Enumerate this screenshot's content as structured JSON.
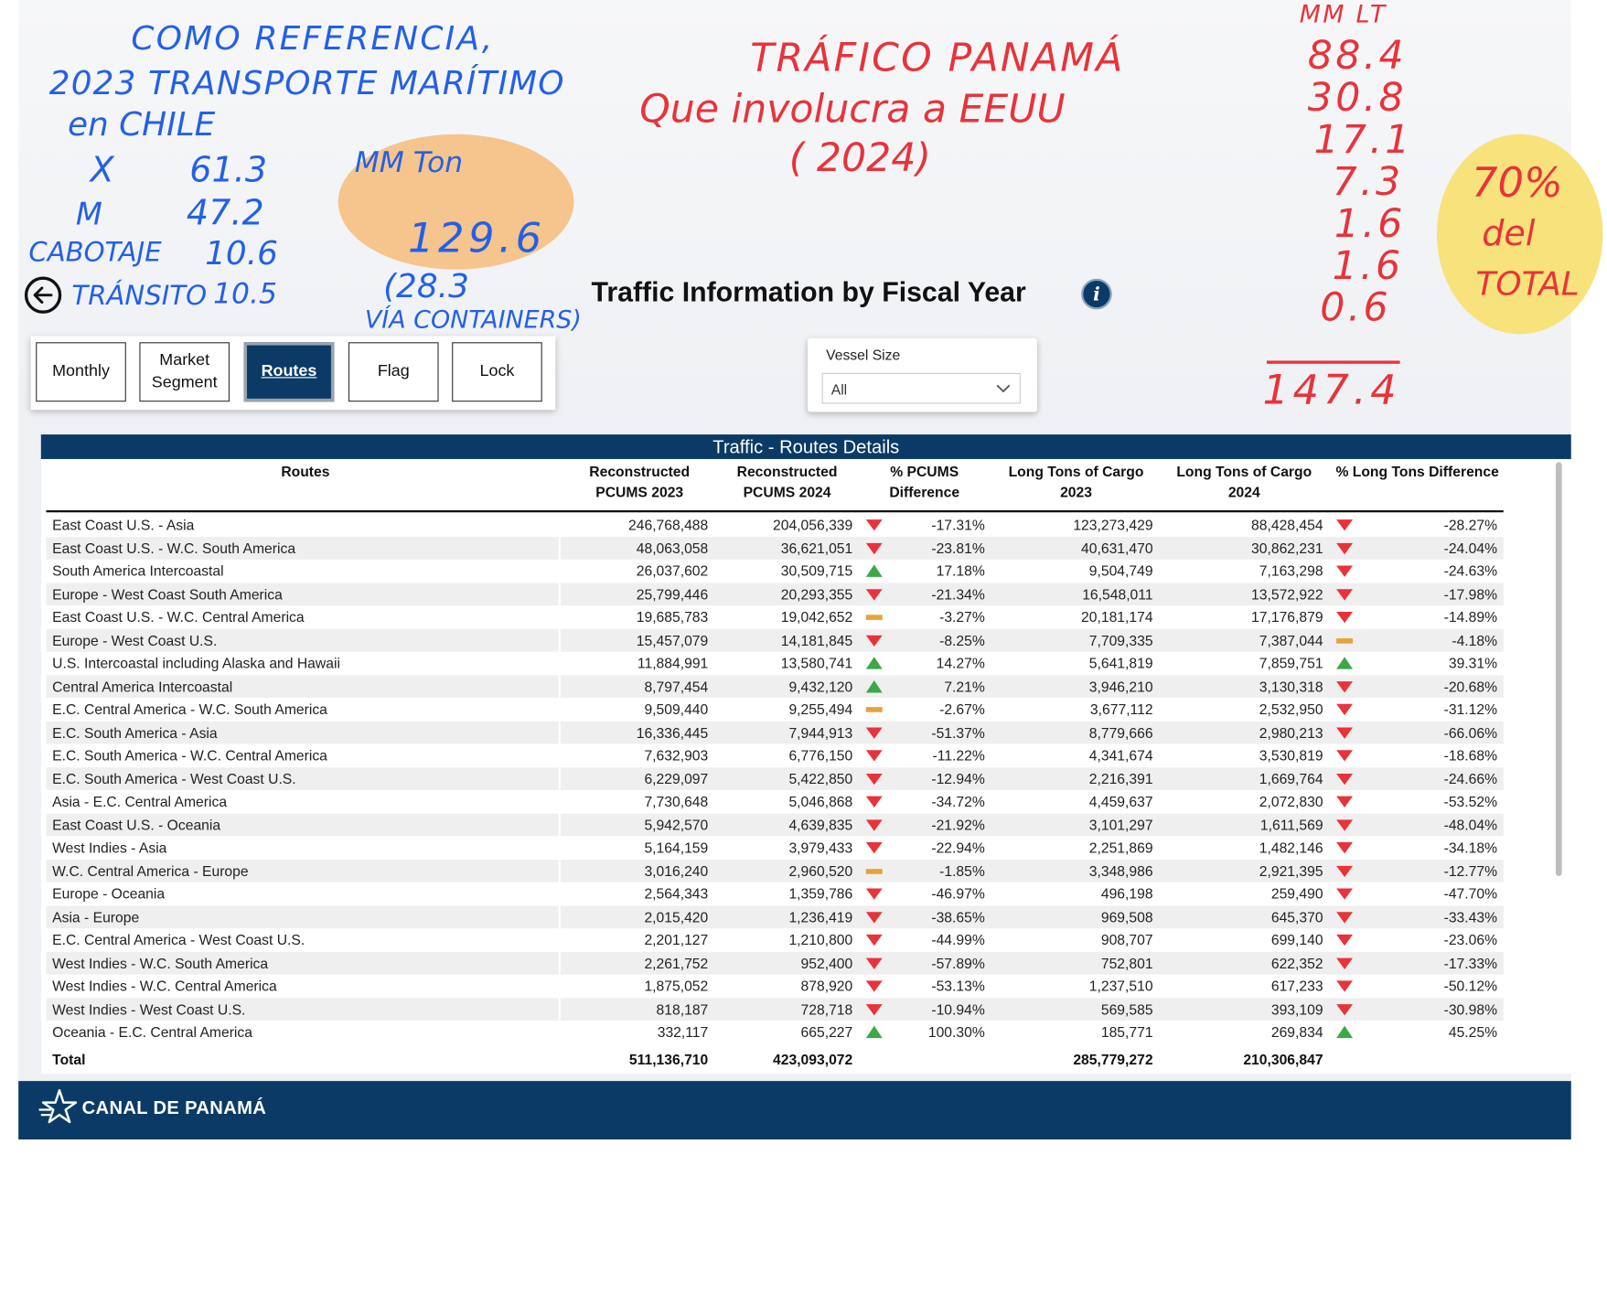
{
  "page": {
    "title": "Traffic Information by Fiscal Year",
    "info_icon_text": "i"
  },
  "nav": {
    "buttons": [
      {
        "label": "Monthly",
        "active": false
      },
      {
        "label": "Market Segment",
        "active": false
      },
      {
        "label": "Routes",
        "active": true
      },
      {
        "label": "Flag",
        "active": false
      },
      {
        "label": "Lock",
        "active": false
      }
    ]
  },
  "slicer": {
    "label": "Vessel Size",
    "value": "All"
  },
  "table": {
    "title": "Traffic - Routes Details",
    "columns": {
      "routes": "Routes",
      "pcums2023": "Reconstructed PCUMS 2023",
      "pcums2024": "Reconstructed PCUMS 2024",
      "pcums_diff": "% PCUMS Difference",
      "lt2023": "Long Tons of Cargo 2023",
      "lt2024": "Long Tons of Cargo 2024",
      "lt_diff": "% Long Tons Difference"
    },
    "rows": [
      {
        "route": "East Coast U.S. - Asia",
        "p23": "246,768,488",
        "p24": "204,056,339",
        "pi": "down",
        "pd": "-17.31%",
        "l23": "123,273,429",
        "l24": "88,428,454",
        "li": "down",
        "ld": "-28.27%"
      },
      {
        "route": "East Coast U.S. - W.C. South America",
        "p23": "48,063,058",
        "p24": "36,621,051",
        "pi": "down",
        "pd": "-23.81%",
        "l23": "40,631,470",
        "l24": "30,862,231",
        "li": "down",
        "ld": "-24.04%"
      },
      {
        "route": "South America Intercoastal",
        "p23": "26,037,602",
        "p24": "30,509,715",
        "pi": "up",
        "pd": "17.18%",
        "l23": "9,504,749",
        "l24": "7,163,298",
        "li": "down",
        "ld": "-24.63%"
      },
      {
        "route": "Europe - West Coast South America",
        "p23": "25,799,446",
        "p24": "20,293,355",
        "pi": "down",
        "pd": "-21.34%",
        "l23": "16,548,011",
        "l24": "13,572,922",
        "li": "down",
        "ld": "-17.98%"
      },
      {
        "route": "East Coast U.S. - W.C. Central America",
        "p23": "19,685,783",
        "p24": "19,042,652",
        "pi": "flat",
        "pd": "-3.27%",
        "l23": "20,181,174",
        "l24": "17,176,879",
        "li": "down",
        "ld": "-14.89%"
      },
      {
        "route": "Europe - West Coast U.S.",
        "p23": "15,457,079",
        "p24": "14,181,845",
        "pi": "down",
        "pd": "-8.25%",
        "l23": "7,709,335",
        "l24": "7,387,044",
        "li": "flat",
        "ld": "-4.18%"
      },
      {
        "route": "U.S. Intercoastal including Alaska and Hawaii",
        "p23": "11,884,991",
        "p24": "13,580,741",
        "pi": "up",
        "pd": "14.27%",
        "l23": "5,641,819",
        "l24": "7,859,751",
        "li": "up",
        "ld": "39.31%"
      },
      {
        "route": "Central America Intercoastal",
        "p23": "8,797,454",
        "p24": "9,432,120",
        "pi": "up",
        "pd": "7.21%",
        "l23": "3,946,210",
        "l24": "3,130,318",
        "li": "down",
        "ld": "-20.68%"
      },
      {
        "route": "E.C. Central America - W.C. South America",
        "p23": "9,509,440",
        "p24": "9,255,494",
        "pi": "flat",
        "pd": "-2.67%",
        "l23": "3,677,112",
        "l24": "2,532,950",
        "li": "down",
        "ld": "-31.12%"
      },
      {
        "route": "E.C. South America - Asia",
        "p23": "16,336,445",
        "p24": "7,944,913",
        "pi": "down",
        "pd": "-51.37%",
        "l23": "8,779,666",
        "l24": "2,980,213",
        "li": "down",
        "ld": "-66.06%"
      },
      {
        "route": "E.C. South America - W.C. Central America",
        "p23": "7,632,903",
        "p24": "6,776,150",
        "pi": "down",
        "pd": "-11.22%",
        "l23": "4,341,674",
        "l24": "3,530,819",
        "li": "down",
        "ld": "-18.68%"
      },
      {
        "route": "E.C. South America - West Coast U.S.",
        "p23": "6,229,097",
        "p24": "5,422,850",
        "pi": "down",
        "pd": "-12.94%",
        "l23": "2,216,391",
        "l24": "1,669,764",
        "li": "down",
        "ld": "-24.66%"
      },
      {
        "route": "Asia - E.C. Central America",
        "p23": "7,730,648",
        "p24": "5,046,868",
        "pi": "down",
        "pd": "-34.72%",
        "l23": "4,459,637",
        "l24": "2,072,830",
        "li": "down",
        "ld": "-53.52%"
      },
      {
        "route": "East Coast U.S. - Oceania",
        "p23": "5,942,570",
        "p24": "4,639,835",
        "pi": "down",
        "pd": "-21.92%",
        "l23": "3,101,297",
        "l24": "1,611,569",
        "li": "down",
        "ld": "-48.04%"
      },
      {
        "route": "West Indies - Asia",
        "p23": "5,164,159",
        "p24": "3,979,433",
        "pi": "down",
        "pd": "-22.94%",
        "l23": "2,251,869",
        "l24": "1,482,146",
        "li": "down",
        "ld": "-34.18%"
      },
      {
        "route": "W.C. Central America - Europe",
        "p23": "3,016,240",
        "p24": "2,960,520",
        "pi": "flat",
        "pd": "-1.85%",
        "l23": "3,348,986",
        "l24": "2,921,395",
        "li": "down",
        "ld": "-12.77%"
      },
      {
        "route": "Europe - Oceania",
        "p23": "2,564,343",
        "p24": "1,359,786",
        "pi": "down",
        "pd": "-46.97%",
        "l23": "496,198",
        "l24": "259,490",
        "li": "down",
        "ld": "-47.70%"
      },
      {
        "route": "Asia - Europe",
        "p23": "2,015,420",
        "p24": "1,236,419",
        "pi": "down",
        "pd": "-38.65%",
        "l23": "969,508",
        "l24": "645,370",
        "li": "down",
        "ld": "-33.43%"
      },
      {
        "route": "E.C. Central America - West Coast U.S.",
        "p23": "2,201,127",
        "p24": "1,210,800",
        "pi": "down",
        "pd": "-44.99%",
        "l23": "908,707",
        "l24": "699,140",
        "li": "down",
        "ld": "-23.06%"
      },
      {
        "route": "West Indies - W.C. South America",
        "p23": "2,261,752",
        "p24": "952,400",
        "pi": "down",
        "pd": "-57.89%",
        "l23": "752,801",
        "l24": "622,352",
        "li": "down",
        "ld": "-17.33%"
      },
      {
        "route": "West Indies - W.C. Central America",
        "p23": "1,875,052",
        "p24": "878,920",
        "pi": "down",
        "pd": "-53.13%",
        "l23": "1,237,510",
        "l24": "617,233",
        "li": "down",
        "ld": "-50.12%"
      },
      {
        "route": "West Indies - West Coast U.S.",
        "p23": "818,187",
        "p24": "728,718",
        "pi": "down",
        "pd": "-10.94%",
        "l23": "569,585",
        "l24": "393,109",
        "li": "down",
        "ld": "-30.98%"
      },
      {
        "route": "Oceania - E.C. Central America",
        "p23": "332,117",
        "p24": "665,227",
        "pi": "up",
        "pd": "100.30%",
        "l23": "185,771",
        "l24": "269,834",
        "li": "up",
        "ld": "45.25%"
      }
    ],
    "total": {
      "label": "Total",
      "p23": "511,136,710",
      "p24": "423,093,072",
      "l23": "285,779,272",
      "l24": "210,306,847"
    }
  },
  "footer": {
    "logo_text": "CANAL DE PANAMÁ"
  },
  "colors": {
    "navy": "#0b3a66",
    "down": "#e8333a",
    "up": "#3fa64a",
    "flat": "#e8a23a",
    "ink_blue": "#2460e6",
    "ink_red": "#e8333a",
    "highlight_orange": "#f5c58d",
    "highlight_yellow": "#f7e27c"
  },
  "annotations": {
    "blue": {
      "line1": "COMO REFERENCIA,",
      "line2": "2023 TRANSPORTE MARÍTIMO",
      "line3": "en CHILE",
      "x_label": "X",
      "x_value": "61.3",
      "m_label": "M",
      "m_value": "47.2",
      "cab_label": "CABOTAJE",
      "cab_value": "10.6",
      "tra_label": "TRÁNSITO",
      "tra_value": "10.5",
      "mm_label": "MM Ton",
      "total": "129.6",
      "cont_value": "(28.3",
      "cont_label": "VÍA CONTAINERS)"
    },
    "red": {
      "title1": "TRÁFICO PANAMÁ",
      "title2": "Que involucra a EEUU",
      "title3": "( 2024)",
      "unit": "MM LT",
      "values": [
        "88.4",
        "30.8",
        "17.1",
        "7.3",
        "1.6",
        "1.6",
        "0.6"
      ],
      "sum": "147.4",
      "pct": "70%",
      "pct_line2": "del",
      "pct_line3": "TOTAL"
    }
  }
}
